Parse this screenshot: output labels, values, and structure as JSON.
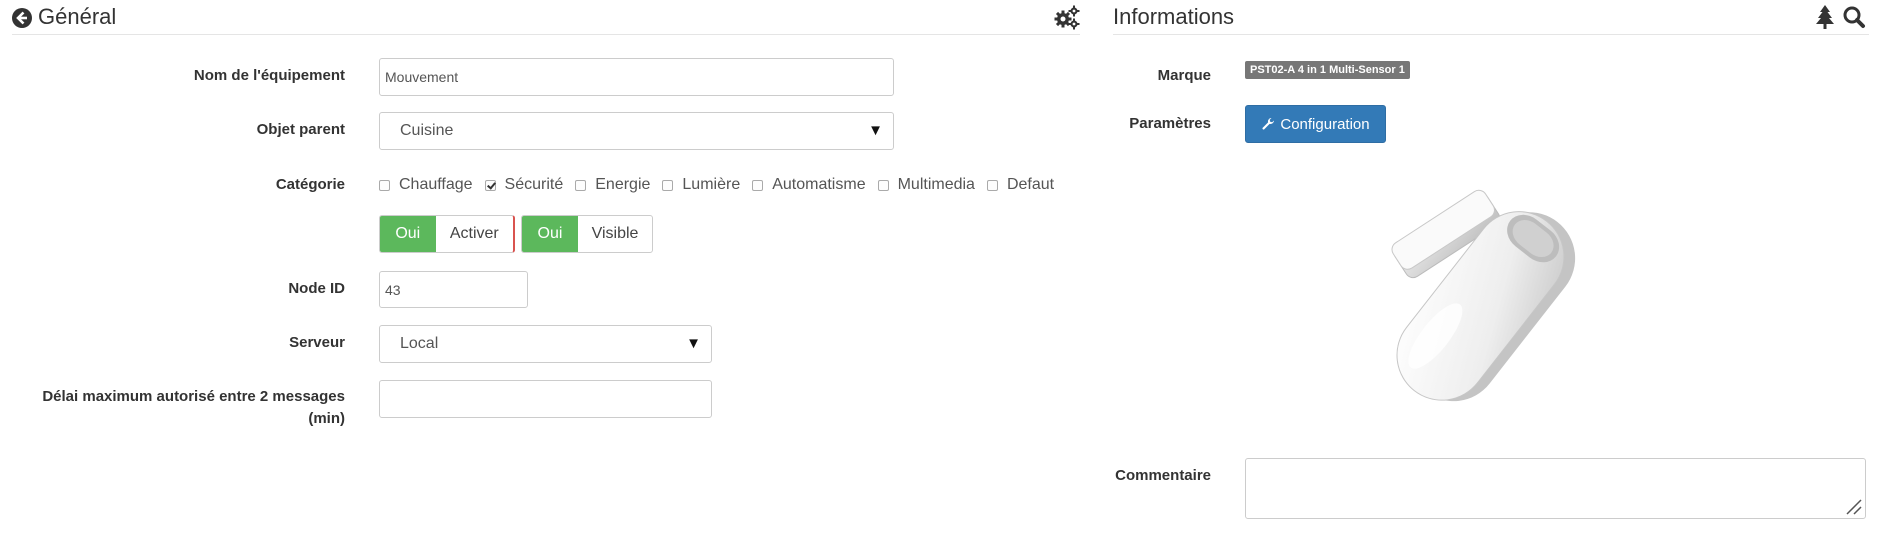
{
  "general": {
    "title": "Général",
    "back_icon": "arrow-circle-left-icon",
    "settings_icon": "gears-icon"
  },
  "form": {
    "name_label": "Nom de l'équipement",
    "name_value": "Mouvement",
    "parent_label": "Objet parent",
    "parent_value": "Cuisine",
    "category_label": "Catégorie",
    "categories": [
      {
        "label": "Chauffage",
        "checked": false
      },
      {
        "label": "Sécurité",
        "checked": true
      },
      {
        "label": "Energie",
        "checked": false
      },
      {
        "label": "Lumière",
        "checked": false
      },
      {
        "label": "Automatisme",
        "checked": false
      },
      {
        "label": "Multimedia",
        "checked": false
      },
      {
        "label": "Defaut",
        "checked": false
      }
    ],
    "activer": {
      "state": "Oui",
      "label": "Activer"
    },
    "visible": {
      "state": "Oui",
      "label": "Visible"
    },
    "node_label": "Node ID",
    "node_value": "43",
    "server_label": "Serveur",
    "server_value": "Local",
    "delay_label_line1": "Délai maximum autorisé entre 2 messages",
    "delay_label_line2": "(min)",
    "delay_value": ""
  },
  "info": {
    "title": "Informations",
    "tree_icon": "tree-icon",
    "search_icon": "search-icon",
    "brand_label": "Marque",
    "brand_value": "PST02-A 4 in 1 Multi-Sensor 1",
    "params_label": "Paramètres",
    "config_button": "Configuration",
    "comment_label": "Commentaire",
    "comment_value": ""
  },
  "colors": {
    "toggle_on": "#5cb85c",
    "primary_button": "#337ab7",
    "badge": "#777777",
    "toggle_separator": "#d9534f"
  }
}
